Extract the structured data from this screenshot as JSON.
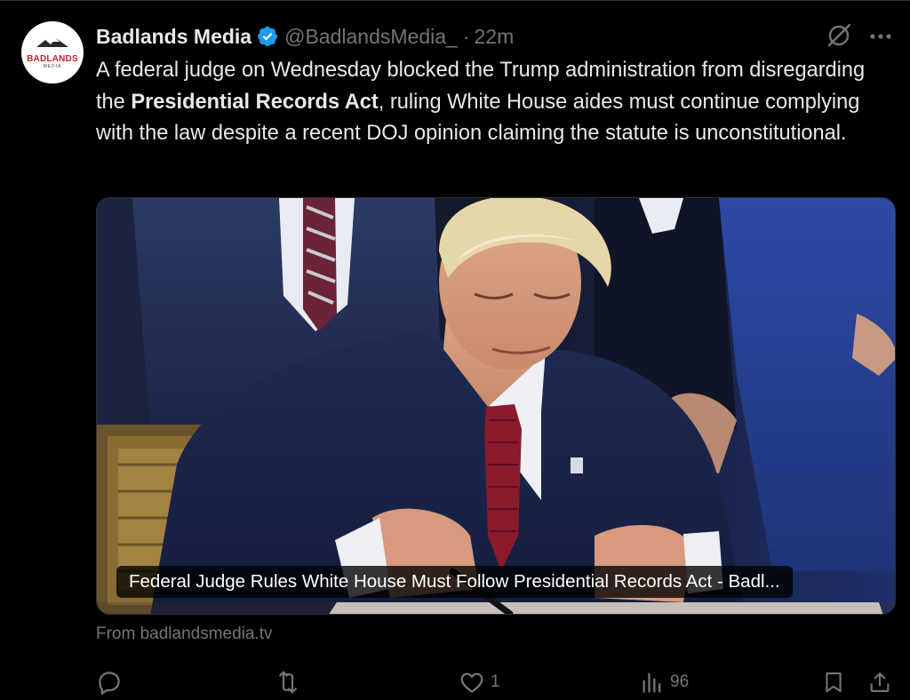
{
  "post": {
    "avatar_text": "BADLANDS",
    "avatar_subtext": "MEDIA",
    "display_name": "Badlands Media",
    "handle": "@BadlandsMedia_",
    "separator": "·",
    "time": "22m",
    "text_part1": "A federal judge on Wednesday blocked the Trump administration from disregarding the ",
    "text_bold": "Presidential Records Act",
    "text_part2": ", ruling White House aides must continue complying with the law despite a recent DOJ opinion claiming the statute is unconstitutional."
  },
  "card": {
    "title": "Federal Judge Rules White House Must Follow Presidential Records Act - Badl...",
    "source": "From badlandsmedia.tv"
  },
  "actions": {
    "replies": "",
    "reposts": "",
    "likes": "1",
    "views": "96"
  },
  "colors": {
    "background": "#000000",
    "text_primary": "#e7e9ea",
    "text_secondary": "#71767b",
    "verified": "#1d9bf0",
    "brand_red": "#c8202a"
  }
}
